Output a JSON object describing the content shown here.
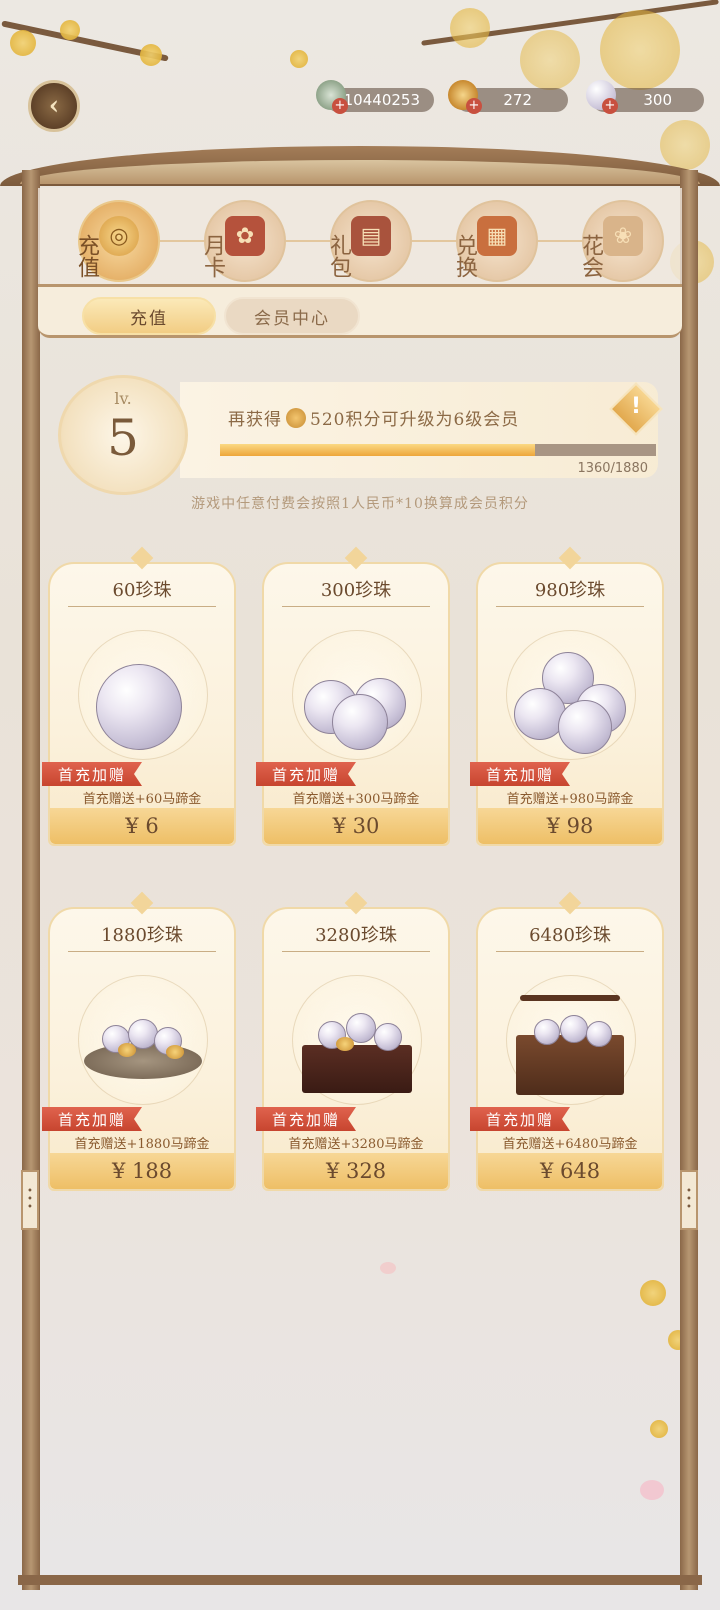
{
  "currencies": [
    {
      "name": "jade-coin",
      "value": "10440253"
    },
    {
      "name": "gold-ingot",
      "value": "272"
    },
    {
      "name": "pearl",
      "value": "300"
    }
  ],
  "tabs": [
    {
      "label": "充值",
      "active": true
    },
    {
      "label": "月卡",
      "active": false
    },
    {
      "label": "礼包",
      "active": false
    },
    {
      "label": "兑换",
      "active": false
    },
    {
      "label": "花会",
      "active": false
    }
  ],
  "subtabs": {
    "recharge": "充值",
    "vip_center": "会员中心"
  },
  "vip": {
    "lv_label": "lv.",
    "level": "5",
    "prefix": "再获得",
    "suffix": "520积分可升级为6级会员",
    "progress_text": "1360/1880",
    "progress": 0.7234,
    "note": "游戏中任意付费会按照1人民币*10换算成会员积分"
  },
  "products": [
    {
      "title": "60珍珠",
      "badge": "首充加赠",
      "bonus": "首充赠送+60马蹄金",
      "price": "¥ 6"
    },
    {
      "title": "300珍珠",
      "badge": "首充加赠",
      "bonus": "首充赠送+300马蹄金",
      "price": "¥ 30"
    },
    {
      "title": "980珍珠",
      "badge": "首充加赠",
      "bonus": "首充赠送+980马蹄金",
      "price": "¥ 98"
    },
    {
      "title": "1880珍珠",
      "badge": "首充加赠",
      "bonus": "首充赠送+1880马蹄金",
      "price": "¥ 188"
    },
    {
      "title": "3280珍珠",
      "badge": "首充加赠",
      "bonus": "首充赠送+3280马蹄金",
      "price": "¥ 328"
    },
    {
      "title": "6480珍珠",
      "badge": "首充加赠",
      "bonus": "首充赠送+6480马蹄金",
      "price": "¥ 648"
    }
  ],
  "colors": {
    "frame": "#8a6748",
    "accent_gold": "#eebf66",
    "ribbon_red": "#c7452f"
  }
}
